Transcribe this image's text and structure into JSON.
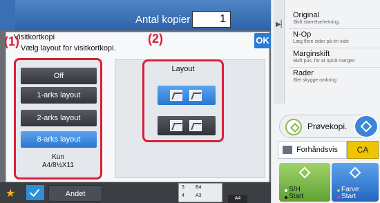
{
  "header": {
    "copies_label": "Antal kopier",
    "copies_value": "1"
  },
  "dialog": {
    "title": "Visitkortkopi",
    "subtitle": "Vælg layout for visitkortkopi.",
    "ok_label": "OK",
    "options": [
      "Off",
      "1-arks layout",
      "2-arks layout",
      "8-arks layout"
    ],
    "selected_option": "8-arks layout",
    "note_line1": "Kun",
    "note_line2": "A4/8½X11",
    "layout_title": "Layout"
  },
  "callouts": {
    "one": "(1)",
    "two": "(2)"
  },
  "right_panel": {
    "items": [
      {
        "title": "Original",
        "sub": "Skift størrelse/retning."
      },
      {
        "title": "N-Op",
        "sub": "Læg flere sider på én side"
      },
      {
        "title": "Marginskift",
        "sub": "Skift pos. for at opnå margen"
      },
      {
        "title": "Rader",
        "sub": "Slet skygge omkring"
      }
    ],
    "preview_label": "Prøvekopi.",
    "preview_label_line": "Forhåndsvis",
    "ca_label": "CA",
    "sh_start_l1": "S/H",
    "sh_start_l2": "Start",
    "color_start_l1": "Farve",
    "color_start_l2": "Start"
  },
  "bottom": {
    "other_label": "Andet",
    "tray_rows": [
      {
        "n": "3",
        "size": "B4"
      },
      {
        "n": "4",
        "size": "A3"
      }
    ],
    "paper_label": "A4"
  },
  "colors": {
    "accent_blue": "#2b77d0",
    "callout_red": "#d91f3a",
    "ca_yellow": "#f0c400"
  }
}
